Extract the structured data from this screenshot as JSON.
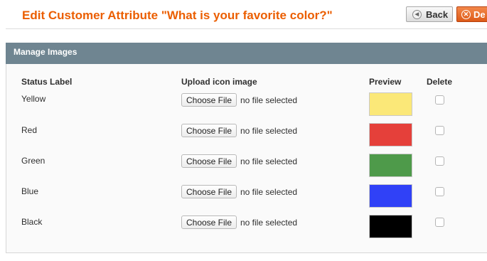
{
  "header": {
    "title": "Edit Customer Attribute \"What is your favorite color?\"",
    "back_label": "Back",
    "delete_label": "De"
  },
  "section": {
    "title": "Manage Images"
  },
  "columns": {
    "status_label": "Status Label",
    "upload": "Upload icon image",
    "preview": "Preview",
    "delete": "Delete"
  },
  "rows": [
    {
      "label": "Yellow",
      "button": "Choose File",
      "file_status": "no file selected",
      "color": "#fbe878",
      "delete_checked": false
    },
    {
      "label": "Red",
      "button": "Choose File",
      "file_status": "no file selected",
      "color": "#e5403a",
      "delete_checked": false
    },
    {
      "label": "Green",
      "button": "Choose File",
      "file_status": "no file selected",
      "color": "#4e9a4a",
      "delete_checked": false
    },
    {
      "label": "Blue",
      "button": "Choose File",
      "file_status": "no file selected",
      "color": "#3041f7",
      "delete_checked": false
    },
    {
      "label": "Black",
      "button": "Choose File",
      "file_status": "no file selected",
      "color": "#000000",
      "delete_checked": false
    }
  ],
  "colors": {
    "title": "#eb5e00",
    "section_header": "#6f8591",
    "delete_button": "#dd5a17"
  }
}
